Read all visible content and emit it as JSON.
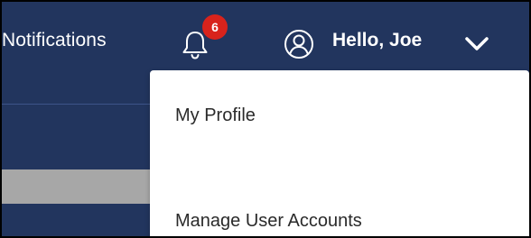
{
  "header": {
    "notifications_label": "Notifications",
    "notification_count": "6",
    "greeting": "Hello, Joe",
    "icons": {
      "bell": "bell-icon",
      "user": "user-circle-icon",
      "chevron": "chevron-down-icon"
    },
    "colors": {
      "header_bg": "#22355e",
      "badge": "#d8231c",
      "text": "#ffffff"
    }
  },
  "user_menu": {
    "items": [
      {
        "label": "My Profile"
      },
      {
        "label": "Manage User Accounts"
      }
    ]
  }
}
